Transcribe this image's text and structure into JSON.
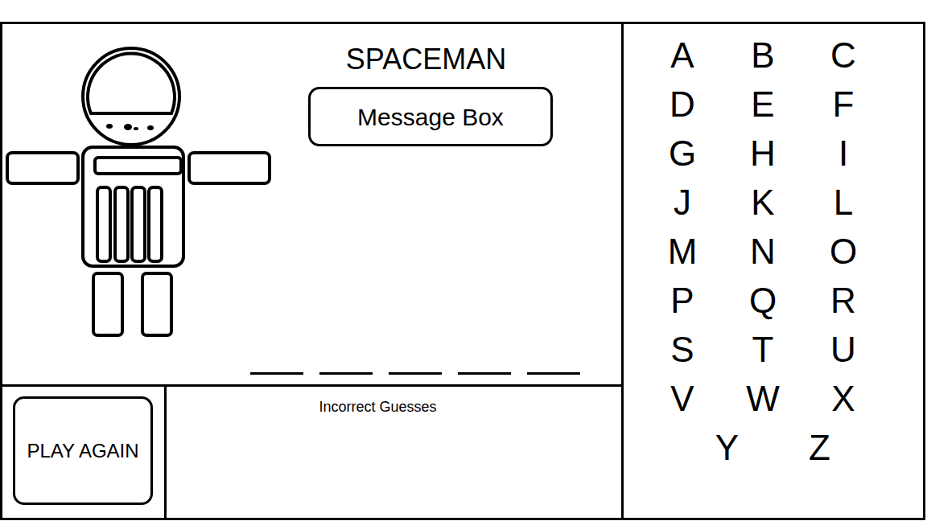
{
  "title": "SPACEMAN",
  "message_box": "Message Box",
  "word_slots": [
    {
      "revealed": false,
      "letter": ""
    },
    {
      "revealed": false,
      "letter": ""
    },
    {
      "revealed": false,
      "letter": ""
    },
    {
      "revealed": false,
      "letter": ""
    },
    {
      "revealed": false,
      "letter": ""
    }
  ],
  "play_again_button": "PLAY AGAIN",
  "incorrect_guesses": {
    "label": "Incorrect Guesses",
    "letters": []
  },
  "letters": [
    {
      "letter": "A",
      "guessed": false
    },
    {
      "letter": "B",
      "guessed": false
    },
    {
      "letter": "C",
      "guessed": false
    },
    {
      "letter": "D",
      "guessed": false
    },
    {
      "letter": "E",
      "guessed": false
    },
    {
      "letter": "F",
      "guessed": false
    },
    {
      "letter": "G",
      "guessed": false
    },
    {
      "letter": "H",
      "guessed": false
    },
    {
      "letter": "I",
      "guessed": false
    },
    {
      "letter": "J",
      "guessed": false
    },
    {
      "letter": "K",
      "guessed": false
    },
    {
      "letter": "L",
      "guessed": false
    },
    {
      "letter": "M",
      "guessed": false
    },
    {
      "letter": "N",
      "guessed": false
    },
    {
      "letter": "O",
      "guessed": false
    },
    {
      "letter": "P",
      "guessed": false
    },
    {
      "letter": "Q",
      "guessed": false
    },
    {
      "letter": "R",
      "guessed": false
    },
    {
      "letter": "S",
      "guessed": false
    },
    {
      "letter": "T",
      "guessed": false
    },
    {
      "letter": "U",
      "guessed": false
    },
    {
      "letter": "V",
      "guessed": false
    },
    {
      "letter": "W",
      "guessed": false
    },
    {
      "letter": "X",
      "guessed": false
    },
    {
      "letter": "Y",
      "guessed": false
    },
    {
      "letter": "Z",
      "guessed": false
    }
  ]
}
